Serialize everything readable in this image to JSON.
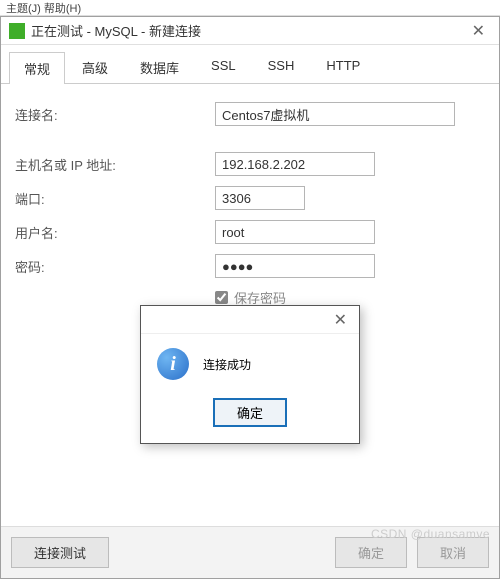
{
  "menubar": "主题(J)  帮助(H)",
  "window": {
    "title": "正在测试 - MySQL - 新建连接"
  },
  "tabs": [
    {
      "label": "常规",
      "active": true
    },
    {
      "label": "高级"
    },
    {
      "label": "数据库"
    },
    {
      "label": "SSL"
    },
    {
      "label": "SSH"
    },
    {
      "label": "HTTP"
    }
  ],
  "form": {
    "conn_label": "连接名:",
    "conn_value": "Centos7虚拟机",
    "host_label": "主机名或 IP 地址:",
    "host_value": "192.168.2.202",
    "port_label": "端口:",
    "port_value": "3306",
    "user_label": "用户名:",
    "user_value": "root",
    "pwd_label": "密码:",
    "pwd_value": "●●●●",
    "save_pwd_label": "保存密码"
  },
  "modal": {
    "message": "连接成功",
    "ok": "确定"
  },
  "footer": {
    "test": "连接测试",
    "ok": "确定",
    "cancel": "取消"
  },
  "watermark": "CSDN @duansamve"
}
